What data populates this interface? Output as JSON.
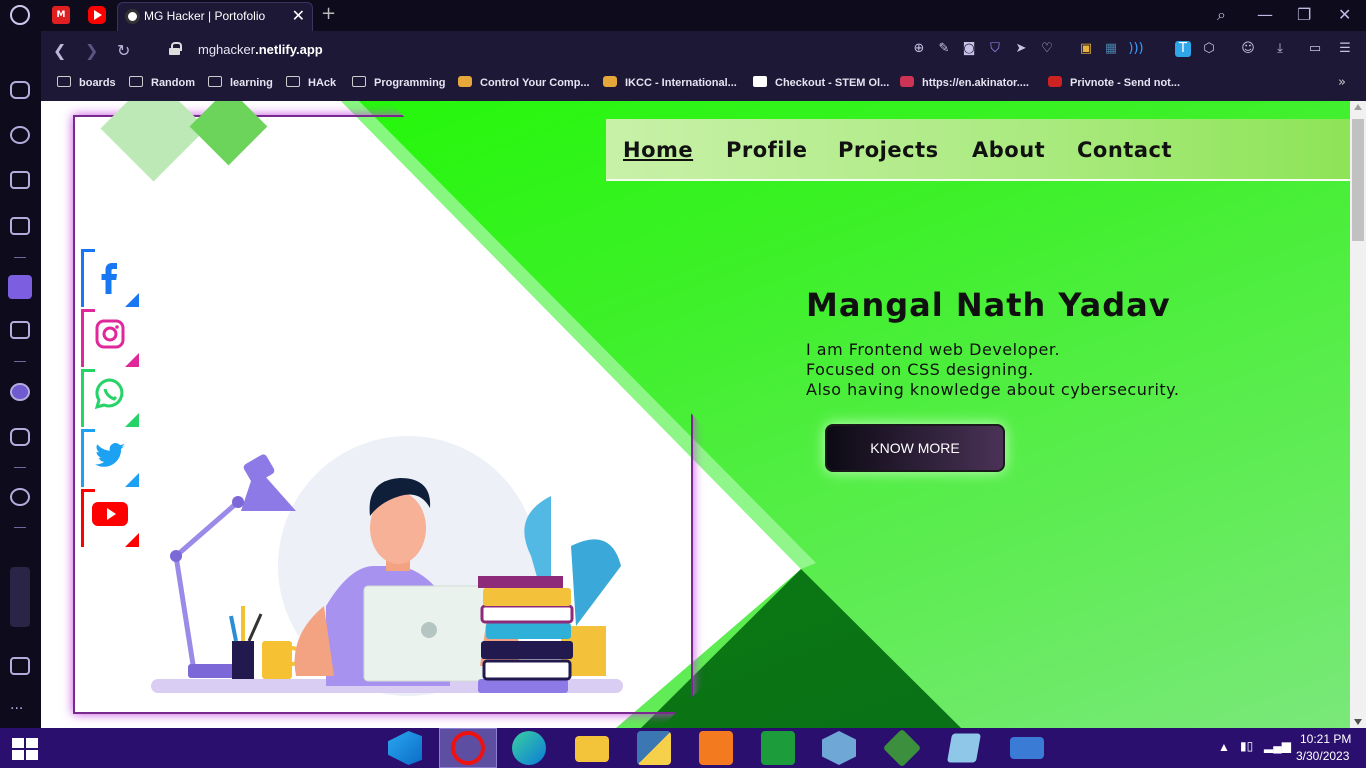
{
  "browser": {
    "pinned_tabs": [
      {
        "icon": "mail-icon",
        "label": "M"
      },
      {
        "icon": "youtube-icon"
      }
    ],
    "active_tab": {
      "title": "MG Hacker | Portofolio",
      "close": "✕"
    },
    "new_tab": "+",
    "url_prefix": "mghacker",
    "url_domain": ".netlify.app",
    "window_controls": {
      "search": "⌕",
      "minimize": "—",
      "restore": "❐",
      "close": "✕"
    }
  },
  "bookmarks": [
    {
      "label": "boards",
      "icon": "folder-icon"
    },
    {
      "label": "Random",
      "icon": "folder-icon"
    },
    {
      "label": "learning",
      "icon": "folder-icon"
    },
    {
      "label": "HAck",
      "icon": "folder-icon"
    },
    {
      "label": "Programming",
      "icon": "folder-icon"
    },
    {
      "label": "Control Your Comp...",
      "icon": "favicon"
    },
    {
      "label": "IKCC - International...",
      "icon": "favicon"
    },
    {
      "label": "Checkout - STEM Ol...",
      "icon": "doc-icon"
    },
    {
      "label": "https://en.akinator....",
      "icon": "favicon"
    },
    {
      "label": "Privnote - Send not...",
      "icon": "favicon"
    }
  ],
  "bookmarks_more": "»",
  "site": {
    "nav": [
      {
        "label": "Home",
        "active": true
      },
      {
        "label": "Profile"
      },
      {
        "label": "Projects"
      },
      {
        "label": "About"
      },
      {
        "label": "Contact"
      }
    ],
    "name": "Mangal Nath Yadav",
    "lines": [
      "I am Frontend web Developer.",
      "Focused on CSS designing.",
      "Also having knowledge about cybersecurity."
    ],
    "cta": "KNOW MORE",
    "social": [
      {
        "name": "facebook",
        "color": "#1877f2"
      },
      {
        "name": "instagram",
        "color": "#e0289a"
      },
      {
        "name": "whatsapp",
        "color": "#25d366"
      },
      {
        "name": "twitter",
        "color": "#1da1f2"
      },
      {
        "name": "youtube",
        "color": "#ff0000"
      }
    ]
  },
  "taskbar": {
    "apps": [
      "vscode",
      "opera",
      "edge",
      "file-explorer",
      "python",
      "xampp",
      "microsoft-store",
      "virtualbox",
      "git",
      "notepad",
      "network"
    ],
    "time": "10:21 PM",
    "date": "3/30/2023"
  }
}
